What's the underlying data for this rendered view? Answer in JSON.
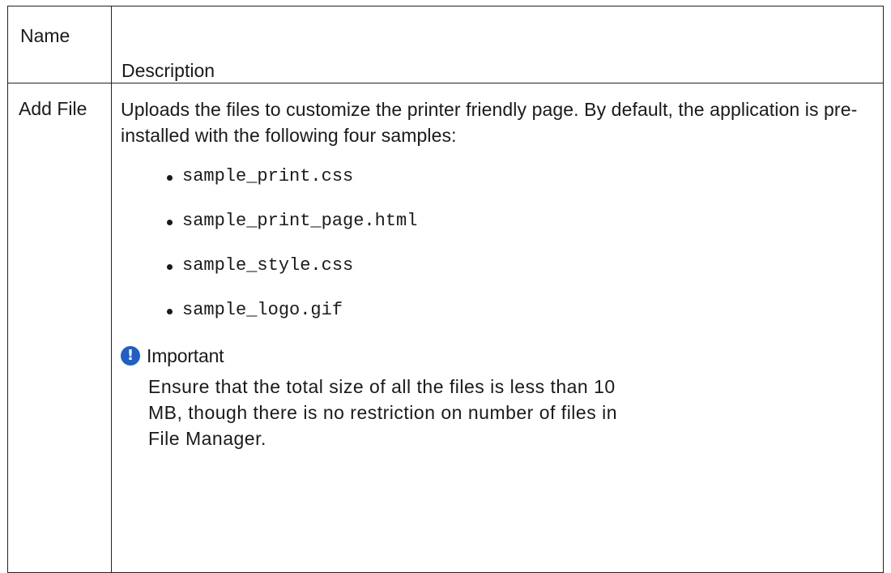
{
  "table": {
    "header": {
      "name": "Name",
      "description": "Description"
    },
    "row": {
      "name": "Add File",
      "intro": "Uploads the files to customize the printer friendly page. By default,  the application is pre-installed with the following four samples:",
      "samples": [
        "sample_print.css",
        "sample_print_page.html",
        "sample_style.css",
        "sample_logo.gif"
      ],
      "note": {
        "icon": "exclamation-circle-icon",
        "icon_color": "#1f5fc6",
        "title": "Important",
        "text": "Ensure that the total size of all the files is less than 10 MB, though there is no restriction on number of files in File Manager."
      }
    }
  }
}
